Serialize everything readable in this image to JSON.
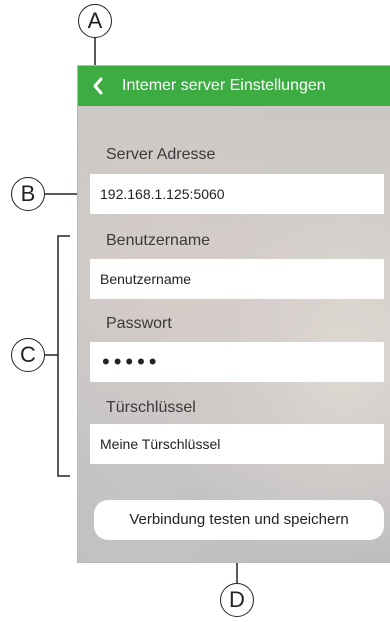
{
  "header": {
    "title": "Intemer server Einstellungen"
  },
  "form": {
    "server_label": "Server Adresse",
    "server_value": "192.168.1.125:5060",
    "username_label": "Benutzername",
    "username_value": "Benutzername",
    "password_label": "Passwort",
    "password_value": "•••••",
    "door_key_label": "Türschlüssel",
    "door_key_value": "Meine Türschlüssel"
  },
  "actions": {
    "save_label": "Verbindung testen und speichern"
  },
  "callouts": {
    "a": "A",
    "b": "B",
    "c": "C",
    "d": "D"
  },
  "colors": {
    "header_green": "#3cac43",
    "field_bg": "#ffffff"
  },
  "icons": {
    "back": "chevron-left-icon"
  }
}
